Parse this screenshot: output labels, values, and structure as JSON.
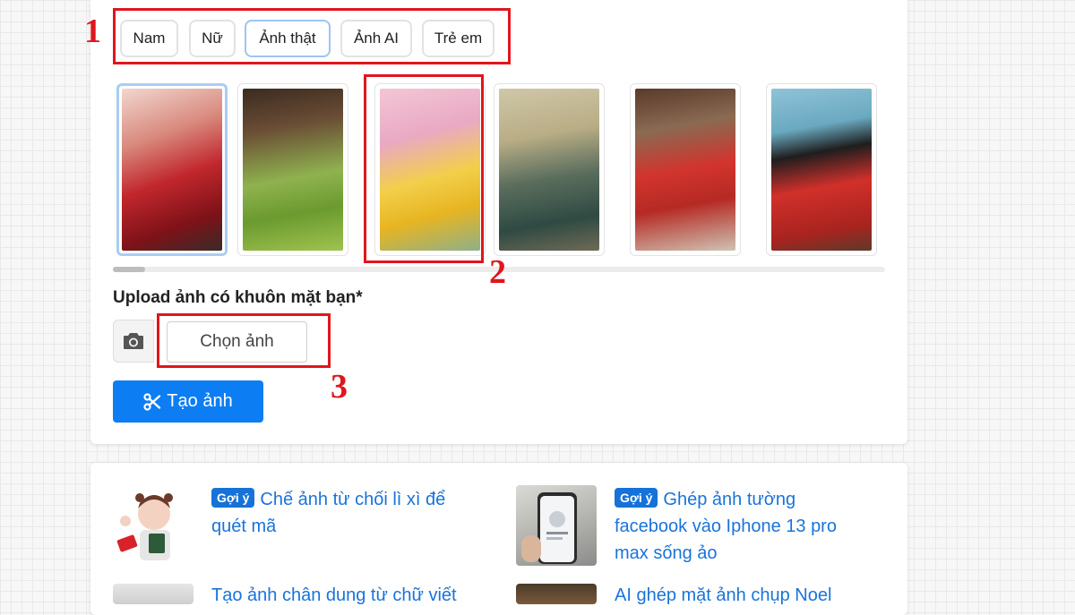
{
  "tabs": [
    {
      "label": "Nam",
      "active": false
    },
    {
      "label": "Nữ",
      "active": false
    },
    {
      "label": "Ảnh thật",
      "active": true
    },
    {
      "label": "Ảnh AI",
      "active": false
    },
    {
      "label": "Trẻ em",
      "active": false
    }
  ],
  "templates": [
    {
      "subject": "woman-red-ao-dai",
      "selected": true
    },
    {
      "subject": "woman-green-pomelos",
      "selected": false
    },
    {
      "subject": "woman-yellow-ao-dai-blossoms",
      "selected": false
    },
    {
      "subject": "man-green-robe",
      "selected": false
    },
    {
      "subject": "child-red-ao-dai",
      "selected": false
    },
    {
      "subject": "man-red-robe",
      "selected": false
    }
  ],
  "upload": {
    "label": "Upload ảnh có khuôn mặt bạn*",
    "camera_icon": "camera-icon",
    "choose_label": "Chọn ảnh"
  },
  "create": {
    "icon": "scissors-icon",
    "label": "Tạo ảnh"
  },
  "annotations": {
    "n1": "1",
    "n2": "2",
    "n3": "3",
    "color": "#e0161d"
  },
  "suggestions": [
    {
      "badge": "Gợi ý",
      "title": "Chế ảnh từ chối lì xì để quét mã"
    },
    {
      "badge": "Gợi ý",
      "title": "Ghép ảnh tường facebook vào Iphone 13 pro max sống ảo"
    },
    {
      "badge": "",
      "title": "Tạo ảnh chân dung từ chữ viết"
    },
    {
      "badge": "",
      "title": "AI ghép mặt ảnh chụp Noel"
    }
  ],
  "colors": {
    "accent": "#0d7df3",
    "link": "#1a73d9",
    "badge": "#1572d8",
    "selected_border": "#a9cdf5"
  }
}
